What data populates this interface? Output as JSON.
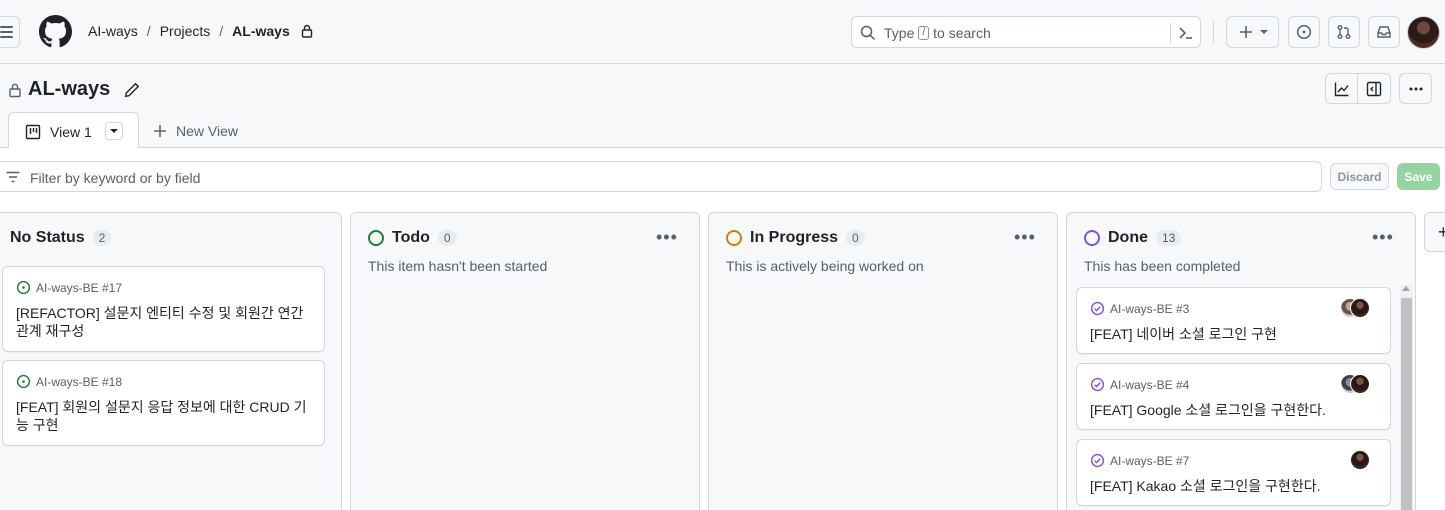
{
  "header": {
    "breadcrumbs": [
      "AI-ways",
      "Projects",
      "AL-ways"
    ],
    "search_placeholder_pre": "Type",
    "search_key": "/",
    "search_placeholder_post": "to search"
  },
  "project": {
    "title": "AL-ways"
  },
  "tabs": {
    "active_label": "View 1",
    "new_view_label": "New View"
  },
  "filter": {
    "placeholder": "Filter by keyword or by field",
    "discard_label": "Discard",
    "save_label": "Save"
  },
  "columns": [
    {
      "name": "No Status",
      "count": "2",
      "description": "",
      "cards": [
        {
          "ref": "AI-ways-BE #17",
          "title": "[REFACTOR] 설문지 엔티티 수정 및 회원간 연간관계 재구성"
        },
        {
          "ref": "AI-ways-BE #18",
          "title": "[FEAT] 회원의 설문지 응답 정보에 대한 CRUD 기능 구현"
        }
      ]
    },
    {
      "name": "Todo",
      "count": "0",
      "description": "This item hasn't been started",
      "status_color": "#1a7f37",
      "cards": []
    },
    {
      "name": "In Progress",
      "count": "0",
      "description": "This is actively being worked on",
      "status_color": "#bf8700",
      "cards": []
    },
    {
      "name": "Done",
      "count": "13",
      "description": "This has been completed",
      "status_color": "#8250df",
      "cards": [
        {
          "ref": "AI-ways-BE #3",
          "title": "[FEAT] 네이버 소셜 로그인 구현"
        },
        {
          "ref": "AI-ways-BE #4",
          "title": "[FEAT] Google 소셜 로그인을 구현한다."
        },
        {
          "ref": "AI-ways-BE #7",
          "title": "[FEAT] Kakao 소셜 로그인을 구현한다."
        }
      ]
    }
  ],
  "colors": {
    "open_issue": "#1a7f37",
    "closed_issue": "#8250df",
    "save_button": "#94d3a2"
  }
}
